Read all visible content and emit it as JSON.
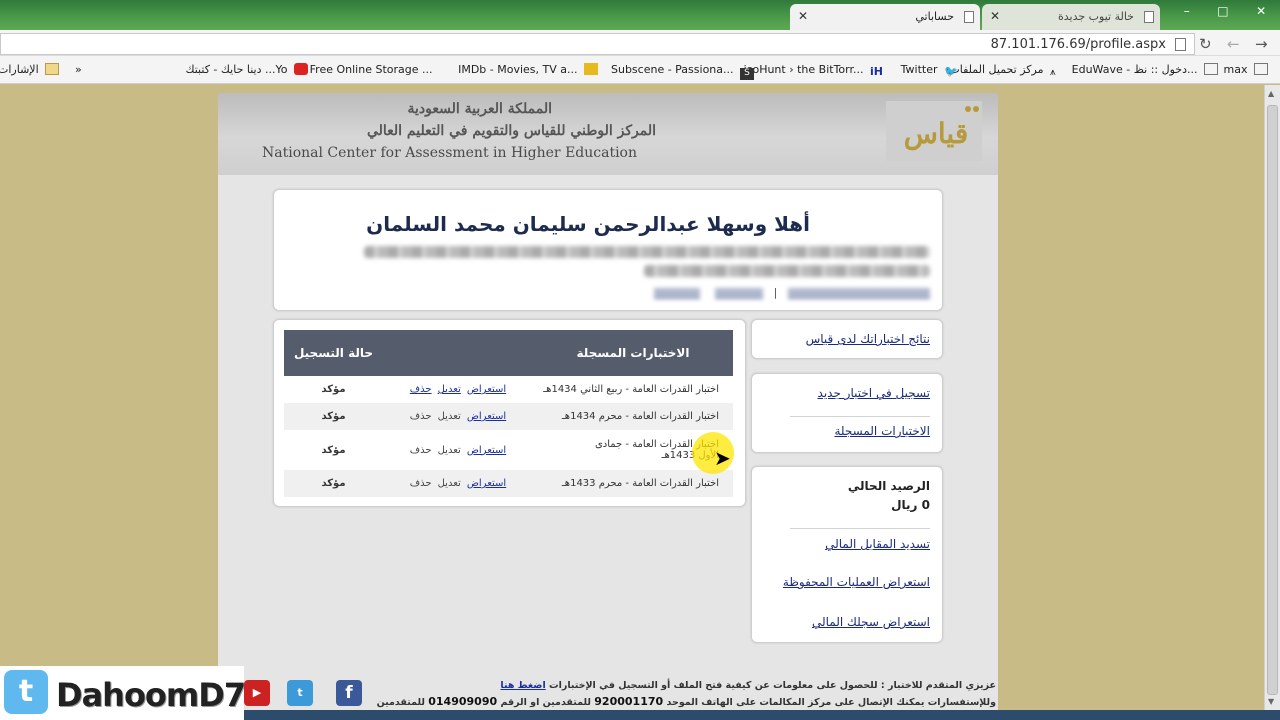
{
  "browser": {
    "tabs": [
      {
        "label": "حساباتي",
        "active": true
      },
      {
        "label": "خالة تيوب جديدة",
        "active": false
      }
    ],
    "window_controls": [
      "–",
      "□",
      "✕"
    ],
    "url": "87.101.176.69/profile.aspx",
    "bookmarks": [
      {
        "label": "max",
        "icon": "page-icon"
      },
      {
        "label": "EduWave - دخول :: نظ...",
        "icon": "page-icon"
      },
      {
        "label": "مركز تحميل الملفات",
        "icon": "upload-icon"
      },
      {
        "label": "Twitter",
        "icon": "twitter-icon"
      },
      {
        "label": "isoHunt › the BitTorr...",
        "icon": "isohunt-icon"
      },
      {
        "label": "Subscene - Passiona...",
        "icon": "subscene-icon"
      },
      {
        "label": "IMDb - Movies, TV a...",
        "icon": "imdb-icon"
      },
      {
        "label": "Free Online Storage ...",
        "icon": "storage-icon"
      },
      {
        "label": "دينا حايك - كتبتك ...Yo",
        "icon": "youtube-icon"
      },
      {
        "label": "الإشارات",
        "icon": "folder-icon"
      }
    ],
    "bookmarks_overflow": "»"
  },
  "site": {
    "header": {
      "arabic_line1": "المملكة العربية السعودية",
      "arabic_line2": "المركز الوطني للقياس والتقويم في التعليم العالي",
      "english_line": "National Center for Assessment in Higher Education",
      "logo_text": "قياس"
    },
    "welcome": {
      "title": "أهلا وسهلا     عبدالرحمن سليمان محمد السلمان"
    },
    "tests_table": {
      "headers": {
        "name": "الاختبارات المسجلة",
        "status": "حالة التسجيل"
      },
      "rows": [
        {
          "name": "اختبار القدرات العامة - ربيع الثاني 1434هـ",
          "view": "استعراض",
          "edit": "تعديل",
          "delete": "حذف",
          "edit_enabled": true,
          "status": "مؤكد"
        },
        {
          "name": "اختبار القدرات العامة - محرم 1434هـ",
          "view": "استعراض",
          "edit": "تعديل",
          "delete": "حذف",
          "edit_enabled": false,
          "status": "مؤكد"
        },
        {
          "name": "اختبار القدرات العامة - جمادى الأول 1433هـ",
          "view": "استعراض",
          "edit": "تعديل",
          "delete": "حذف",
          "edit_enabled": false,
          "status": "مؤكد"
        },
        {
          "name": "اختبار القدرات العامة - محرم 1433هـ",
          "view": "استعراض",
          "edit": "تعديل",
          "delete": "حذف",
          "edit_enabled": false,
          "status": "مؤكد"
        }
      ]
    },
    "sidebar": {
      "results_link": "نتائج اختباراتك لدى قياس",
      "register_link": "تسجيل في اختبار جديد",
      "registered_tests_link": "الاختبارات المسجلة",
      "balance_label": "الرصيد الحالي",
      "balance_value": "0 ريال",
      "pay_link": "تسديد المقابل المالي",
      "saved_ops_link": "استعراض العمليات المحفوظة",
      "finance_log_link": "استعراض سجلك المالي"
    },
    "footer": {
      "line1": "عزيزي المتقدم للاختبار : للحصول على معلومات عن كيفية فتح الملف أو التسجيل في الإختبارات",
      "line1_link": "اضغط هنا",
      "line2_prefix": "وللإستفسارات يمكنك الإتصال على مركز المكالمات على الهاتف الموحد",
      "phone1": "920001170",
      "line2_mid": "للمتقدمين او الرقم",
      "phone2": "014909090",
      "line2_suffix": "للمتقدمين"
    }
  },
  "overlay": {
    "watermark_name": "DahoomD7",
    "social": {
      "youtube": "You Tube",
      "twitter": "t",
      "facebook": "f"
    }
  },
  "colors": {
    "page_background": "#c9bb86",
    "table_header": "#555d6c",
    "link": "#1a2f9e",
    "title": "#1d2b4f",
    "tabstrip": "#4c9b4a"
  }
}
